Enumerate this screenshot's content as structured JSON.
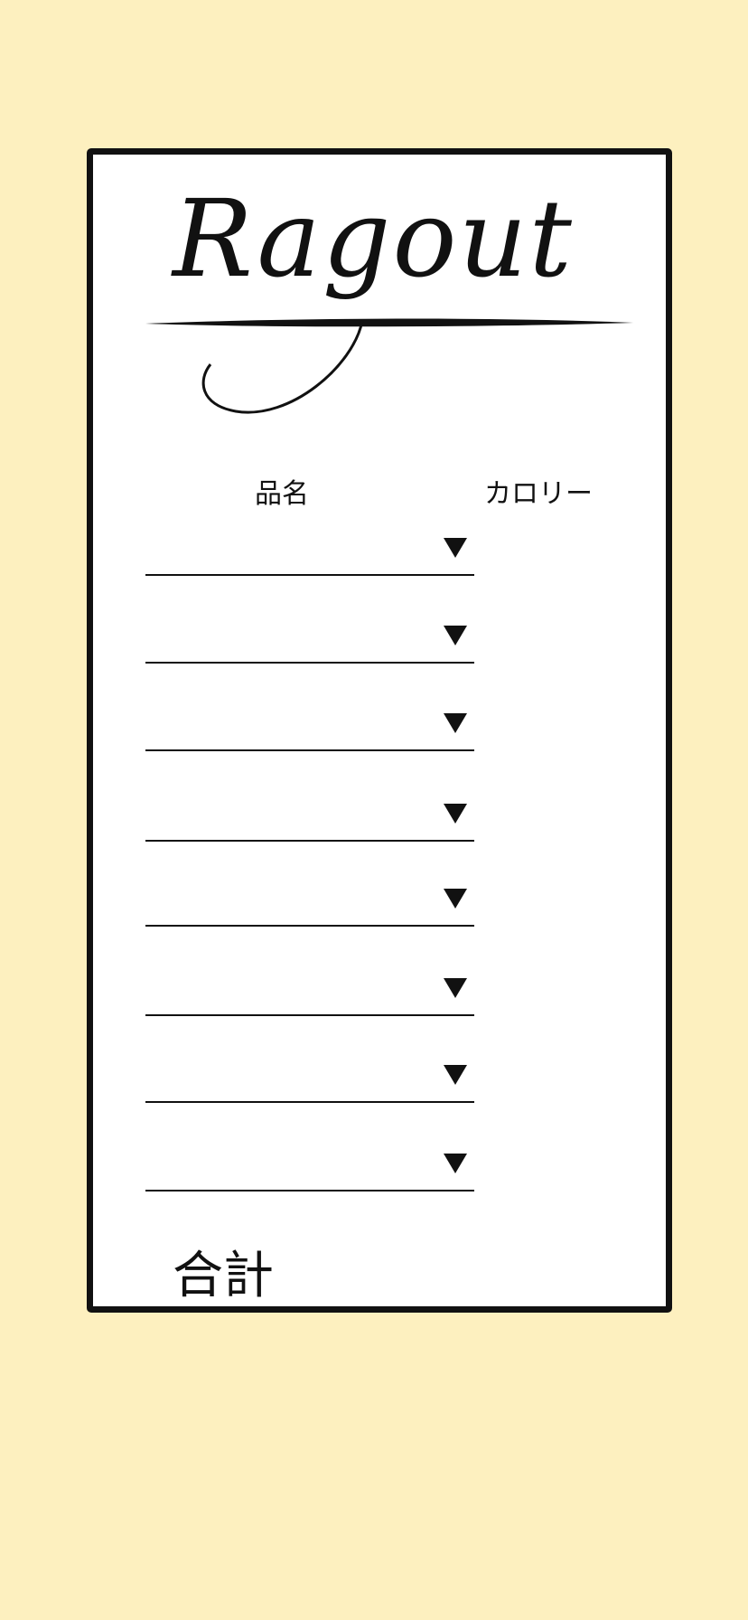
{
  "app": {
    "logo_text": "Ragout"
  },
  "headers": {
    "item_name": "品名",
    "calories": "カロリー"
  },
  "rows": [
    {
      "item": "",
      "calories": "",
      "dropdown_icon": "triangle-down-icon"
    },
    {
      "item": "",
      "calories": "",
      "dropdown_icon": "triangle-down-icon"
    },
    {
      "item": "",
      "calories": "",
      "dropdown_icon": "triangle-down-icon"
    },
    {
      "item": "",
      "calories": "",
      "dropdown_icon": "triangle-down-icon"
    },
    {
      "item": "",
      "calories": "",
      "dropdown_icon": "triangle-down-icon"
    },
    {
      "item": "",
      "calories": "",
      "dropdown_icon": "triangle-down-icon"
    },
    {
      "item": "",
      "calories": "",
      "dropdown_icon": "triangle-down-icon"
    },
    {
      "item": "",
      "calories": "",
      "dropdown_icon": "triangle-down-icon"
    }
  ],
  "total": {
    "label": "合計"
  },
  "colors": {
    "background": "#fdf0bf",
    "card": "#ffffff",
    "ink": "#111111"
  }
}
